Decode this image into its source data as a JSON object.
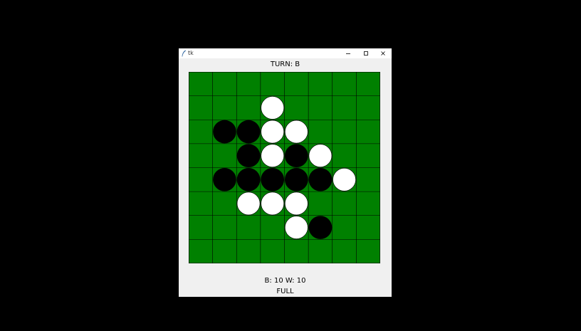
{
  "window": {
    "title": "tk"
  },
  "game": {
    "turn_text": "TURN: B",
    "score_text": "B: 10 W: 10",
    "status_text": "FULL",
    "board_size": 8,
    "board": [
      ".......",
      "",
      "",
      "",
      "",
      "",
      "",
      ""
    ],
    "rows": [
      "........",
      "...W....",
      ".BBWW...",
      "..BWBW..",
      ".BBBBBW.",
      "..WWW...",
      "....WB..",
      "........"
    ]
  },
  "colors": {
    "board": "#008000",
    "grid": "#000000",
    "black_piece": "#000000",
    "white_piece": "#ffffff",
    "piece_outline": "#000000"
  }
}
